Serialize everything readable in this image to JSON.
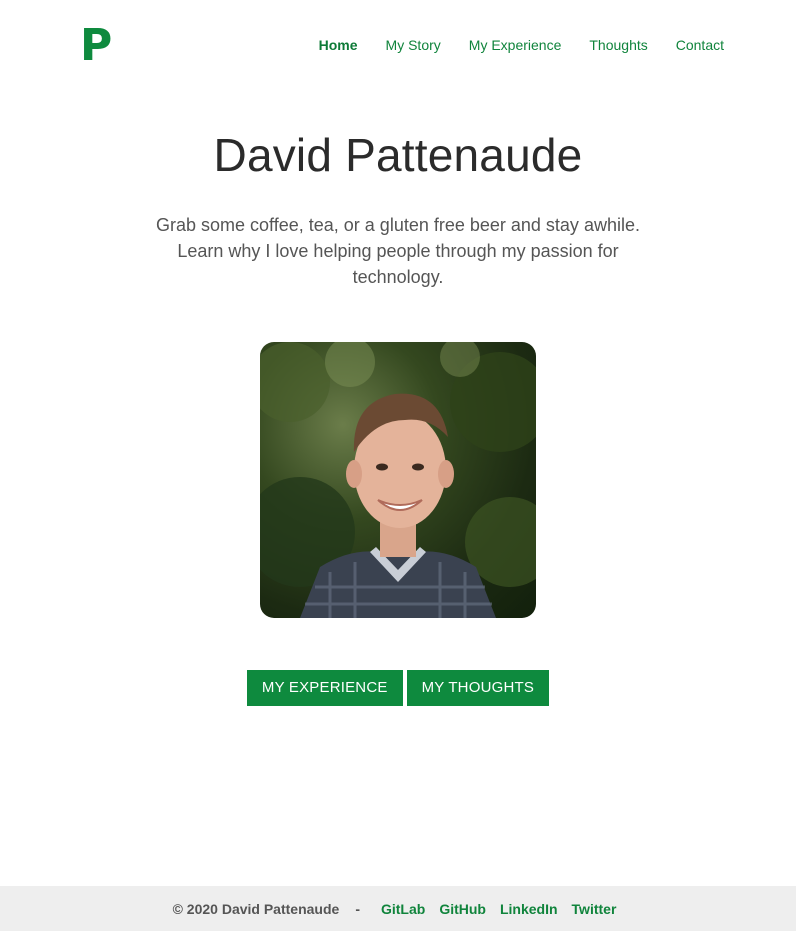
{
  "header": {
    "logo": "P",
    "nav": [
      {
        "label": "Home",
        "active": true
      },
      {
        "label": "My Story"
      },
      {
        "label": "My Experience"
      },
      {
        "label": "Thoughts"
      },
      {
        "label": "Contact"
      }
    ]
  },
  "hero": {
    "title": "David Pattenaude",
    "subtitle": "Grab some coffee, tea, or a gluten free beer and stay awhile. Learn why I love helping people through my passion for technology."
  },
  "buttons": {
    "experience": "MY EXPERIENCE",
    "thoughts": "MY THOUGHTS"
  },
  "footer": {
    "copyright": "© 2020 David Pattenaude",
    "separator": "-",
    "links": [
      "GitLab",
      "GitHub",
      "LinkedIn",
      "Twitter"
    ]
  },
  "colors": {
    "accent": "#0e8a3e",
    "footer_bg": "#eeeeee"
  }
}
